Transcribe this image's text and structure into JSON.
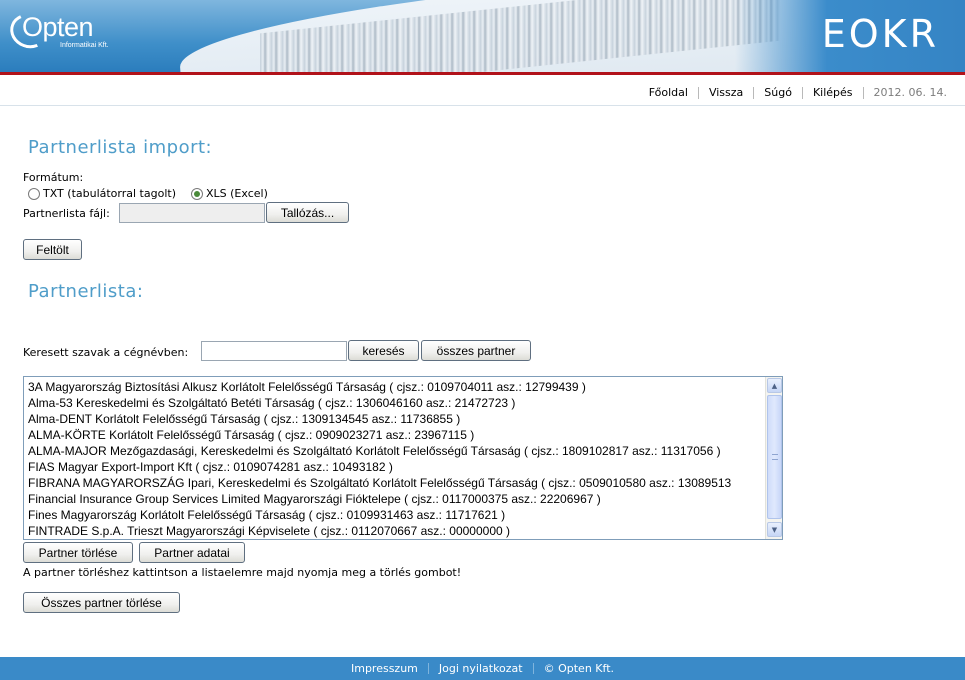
{
  "header": {
    "logo_name": "Opten",
    "logo_sub": "Informatikai Kft.",
    "app_title": "EOKR"
  },
  "topnav": {
    "items": [
      "Főoldal",
      "Vissza",
      "Súgó",
      "Kilépés"
    ],
    "date": "2012. 06. 14."
  },
  "import": {
    "title": "Partnerlista import:",
    "format_label": "Formátum:",
    "radio_txt": "TXT (tabulátorral tagolt)",
    "radio_xls": "XLS (Excel)",
    "selected_format": "XLS (Excel)",
    "file_label": "Partnerlista fájl:",
    "file_value": "",
    "browse_button": "Tallózás...",
    "upload_button": "Feltölt"
  },
  "list": {
    "title": "Partnerlista:",
    "search_label": "Keresett szavak a cégnévben:",
    "search_value": "",
    "search_button": "keresés",
    "all_button": "összes partner",
    "items": [
      "3A Magyarország Biztosítási Alkusz Korlátolt Felelősségű Társaság ( cjsz.: 0109704011 asz.: 12799439 )",
      "Alma-53 Kereskedelmi és Szolgáltató Betéti Társaság ( cjsz.: 1306046160 asz.: 21472723 )",
      "Alma-DENT Korlátolt Felelősségű Társaság ( cjsz.: 1309134545 asz.: 11736855 )",
      "ALMA-KÖRTE Korlátolt Felelősségű Társaság ( cjsz.: 0909023271 asz.: 23967115 )",
      "ALMA-MAJOR Mezőgazdasági, Kereskedelmi és Szolgáltató Korlátolt Felelősségű Társaság ( cjsz.: 1809102817 asz.: 11317056 )",
      "FIAS Magyar Export-Import Kft ( cjsz.: 0109074281 asz.: 10493182 )",
      "FIBRANA MAGYARORSZÁG Ipari, Kereskedelmi és Szolgáltató Korlátolt Felelősségű Társaság ( cjsz.: 0509010580 asz.: 13089513",
      "Financial Insurance Group Services Limited Magyarországi Fióktelepe ( cjsz.: 0117000375 asz.: 22206967 )",
      "Fines Magyarország Korlátolt Felelősségű Társaság ( cjsz.: 0109931463 asz.: 11717621 )",
      "FINTRADE S.p.A. Trieszt Magyarországi Képviselete ( cjsz.: 0112070667 asz.: 00000000 )"
    ],
    "delete_button": "Partner törlése",
    "details_button": "Partner adatai",
    "hint": "A partner törléshez kattintson a listaelemre majd nyomja meg a törlés gombot!",
    "delete_all_button": "Összes partner törlése"
  },
  "footer": {
    "items": [
      "Impresszum",
      "Jogi nyilatkozat",
      "© Opten Kft."
    ]
  }
}
